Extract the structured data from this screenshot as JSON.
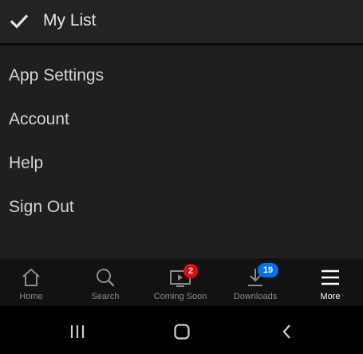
{
  "header": {
    "title": "My List",
    "icon": "check-icon"
  },
  "menu": {
    "items": [
      {
        "label": "App Settings"
      },
      {
        "label": "Account"
      },
      {
        "label": "Help"
      },
      {
        "label": "Sign Out"
      }
    ]
  },
  "tabbar": {
    "tabs": [
      {
        "label": "Home",
        "icon": "home-icon"
      },
      {
        "label": "Search",
        "icon": "search-icon"
      },
      {
        "label": "Coming Soon",
        "icon": "tv-play-icon",
        "badge": "2",
        "badge_color": "#e50914"
      },
      {
        "label": "Downloads",
        "icon": "download-icon",
        "badge": "19",
        "badge_color": "#0071eb"
      },
      {
        "label": "More",
        "icon": "menu-icon",
        "active": true
      }
    ]
  },
  "system_nav": {
    "buttons": [
      "recent-apps-icon",
      "home-button-icon",
      "back-icon"
    ]
  },
  "colors": {
    "background": "#1f1f1f",
    "tabbar": "#121212",
    "navbar": "#000000",
    "badge_red": "#e50914",
    "badge_blue": "#0071eb"
  }
}
